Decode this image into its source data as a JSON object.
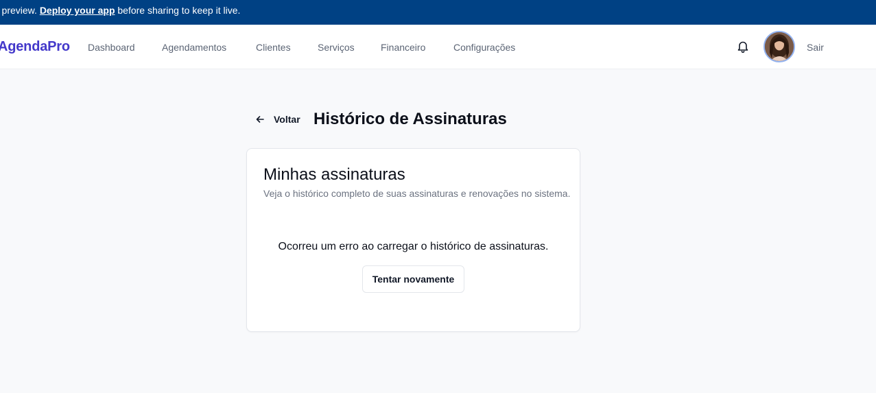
{
  "banner": {
    "prefix": "ry preview. ",
    "link": "Deploy your app",
    "suffix": " before sharing to keep it live."
  },
  "nav": {
    "brand": "AgendaPro",
    "items": [
      {
        "label": "Dashboard"
      },
      {
        "label": "Agendamentos"
      },
      {
        "label": "Clientes"
      },
      {
        "label": "Serviços"
      },
      {
        "label": "Financeiro"
      },
      {
        "label": "Configurações"
      }
    ],
    "logout": "Sair",
    "icons": {
      "notifications": "bell-icon",
      "avatar": "user-avatar"
    }
  },
  "page": {
    "back_label": "Voltar",
    "title": "Histórico de Assinaturas"
  },
  "card": {
    "title": "Minhas assinaturas",
    "subtitle": "Veja o histórico completo de suas assinaturas e renovações no sistema.",
    "error": "Ocorreu um erro ao carregar o histórico de assinaturas.",
    "retry_label": "Tentar novamente"
  },
  "colors": {
    "banner_bg": "#004184",
    "brand": "#4338ca",
    "page_bg": "#f8f9fb",
    "nav_text": "#5b6474"
  }
}
